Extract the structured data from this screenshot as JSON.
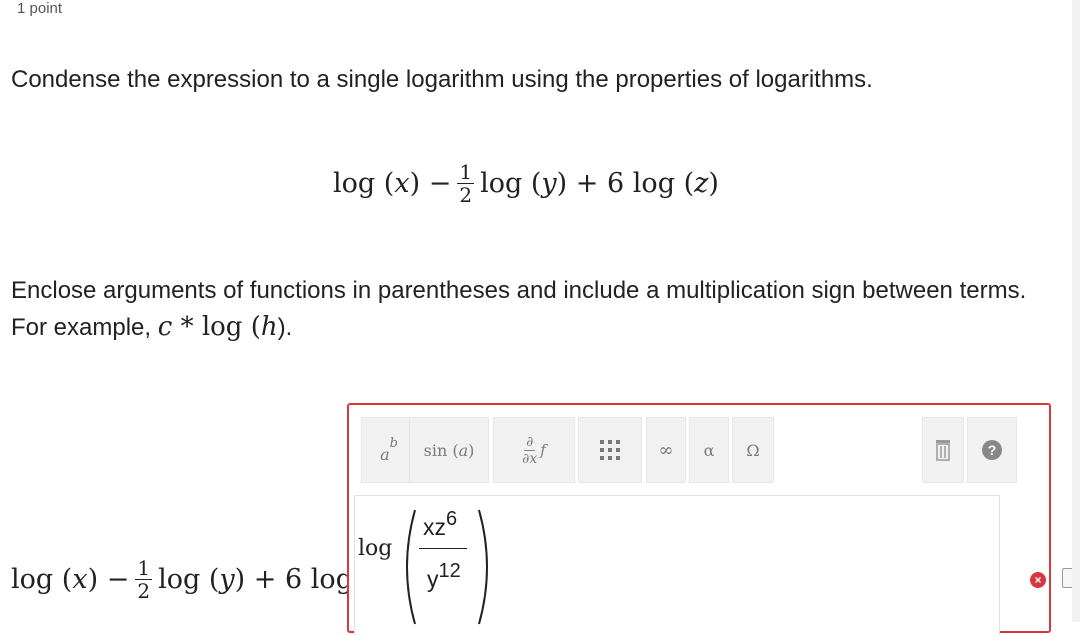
{
  "question": {
    "points": "1 point",
    "prompt": "Condense the expression to a single logarithm using the properties of logarithms.",
    "instructions_text": "Enclose arguments of functions in parentheses and include a multiplication sign between terms. For example,",
    "example_c": "c",
    "example_star": "*",
    "example_log": "log",
    "example_h": "h",
    "example_end": ")."
  },
  "expression": {
    "log": "log",
    "x": "x",
    "y": "y",
    "z": "z",
    "minus": "−",
    "plus": "+",
    "frac_num": "1",
    "frac_den": "2",
    "coef": "6",
    "paren_open": "(",
    "paren_close": ")"
  },
  "toolbar": {
    "superscript_base": "a",
    "superscript_exp": "b",
    "sin_label": "sin",
    "sin_arg": "a",
    "deriv_num": "∂",
    "deriv_den": "∂x",
    "deriv_f": "f",
    "infinity": "∞",
    "alpha": "α",
    "omega": "Ω",
    "help": "?"
  },
  "answer_input": {
    "log": "log",
    "numerator_base": "xz",
    "numerator_exp": "6",
    "denominator_base": "y",
    "denominator_exp": "12"
  },
  "status": {
    "error_mark": "×"
  },
  "colors": {
    "accent_error": "#d9363e",
    "toolbar_bg": "#f1f1f1"
  }
}
